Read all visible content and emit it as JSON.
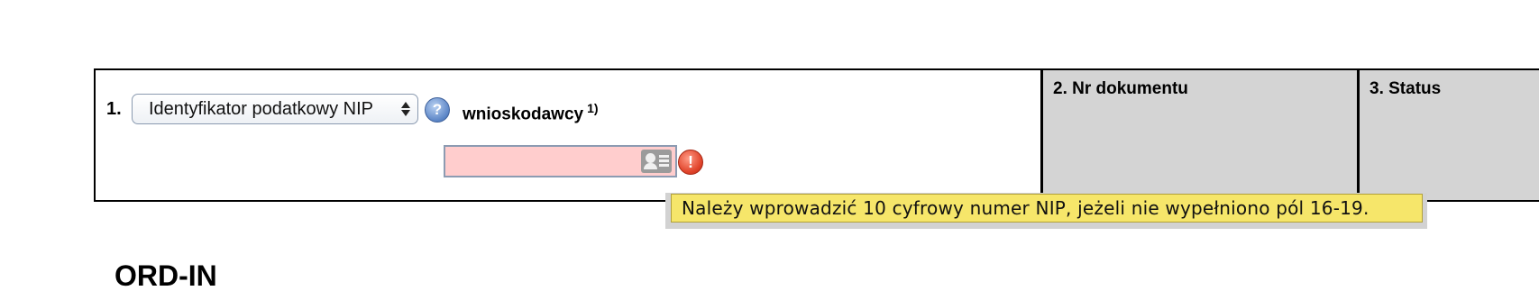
{
  "form": {
    "field_number": "1.",
    "identifier_select": {
      "selected": "Identyfikator podatkowy NIP"
    },
    "help_icon_glyph": "?",
    "applicant_label": "wnioskodawcy",
    "applicant_footnote": "1)",
    "nip_input": {
      "value": "",
      "placeholder": ""
    },
    "error_icon_glyph": "!",
    "doc_number_label": "2. Nr dokumentu",
    "status_label": "3. Status"
  },
  "validation": {
    "tooltip_text": "Należy wprowadzić 10 cyfrowy numer NIP, jeżeli nie wypełniono pól 16-19."
  },
  "section": {
    "title": "ORD-IN"
  },
  "icons": {
    "help": "question-circle-icon",
    "contact_card": "contact-card-icon",
    "error": "exclamation-circle-icon",
    "select_arrows": "up-down-arrows-icon"
  },
  "colors": {
    "input_error_bg": "#ffcdcd",
    "tooltip_bg": "#f6e66a",
    "readonly_cell_bg": "#d4d4d4",
    "error_icon": "#e0432a",
    "help_icon": "#5b85c6"
  }
}
